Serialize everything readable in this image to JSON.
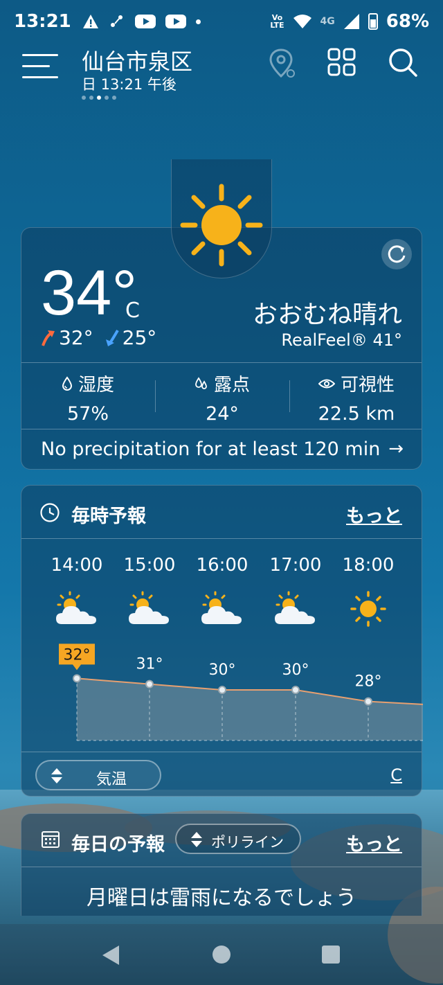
{
  "status_bar": {
    "time": "13:21",
    "battery": "68%",
    "network": "4G",
    "volte_line1": "Vo",
    "volte_line2": "LTE"
  },
  "header": {
    "location": "仙台市泉区",
    "datetime": "日 13:21 午後",
    "menu_icon": "hamburger-menu-icon",
    "location_icon": "location-pin-icon",
    "grid_icon": "grid-icon",
    "search_icon": "search-icon"
  },
  "current": {
    "temp": "34°",
    "unit": "C",
    "high": "32°",
    "low": "25°",
    "condition": "おおむね晴れ",
    "realfeel": "RealFeel® 41°",
    "humidity_label": "湿度",
    "humidity_value": "57%",
    "dewpoint_label": "露点",
    "dewpoint_value": "24°",
    "visibility_label": "可視性",
    "visibility_value": "22.5 km",
    "precip_text": "No precipitation for at least 120 min",
    "precip_arrow": "→"
  },
  "hourly": {
    "title": "毎時予報",
    "more": "もっと",
    "toggle_label": "気温",
    "unit_link": "C",
    "hours": [
      {
        "time": "14:00",
        "temp": "32°",
        "icon": "partly-sunny-icon"
      },
      {
        "time": "15:00",
        "temp": "31°",
        "icon": "partly-sunny-icon"
      },
      {
        "time": "16:00",
        "temp": "30°",
        "icon": "partly-sunny-icon"
      },
      {
        "time": "17:00",
        "temp": "30°",
        "icon": "partly-sunny-icon"
      },
      {
        "time": "18:00",
        "temp": "28°",
        "icon": "sunny-icon"
      }
    ]
  },
  "daily": {
    "title": "毎日の予報",
    "toggle_label": "ポリライン",
    "more": "もっと",
    "message": "月曜日は雷雨になるでしょう"
  },
  "colors": {
    "accent_orange": "#f5a623",
    "sun": "#f7b21a",
    "high_arrow": "#ff6a3d",
    "low_arrow": "#4aa3ff"
  }
}
